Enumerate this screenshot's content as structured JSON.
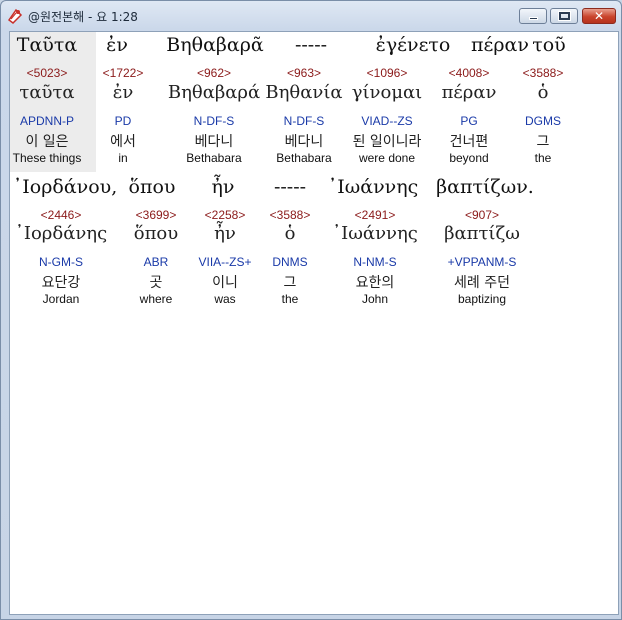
{
  "window": {
    "title": "@원전본해 - 요 1:28",
    "icons": {
      "app": "app-logo-icon",
      "minimize": "minimize-icon",
      "maximize": "maximize-icon",
      "close": "close-icon"
    },
    "close_glyph": "✕"
  },
  "lines": [
    {
      "words": [
        {
          "greek": "Ταῦτα",
          "strong": "<5023>",
          "lemma": "ταῦτα",
          "morph": "APDNN-P",
          "korean": "이 일은",
          "english": "These things"
        },
        {
          "greek": "ἐν",
          "strong": "<1722>",
          "lemma": "ἐν",
          "morph": "PD",
          "korean": "에서",
          "english": "in"
        },
        {
          "greek": "Βηθαβαρᾶ",
          "strong": "<962>",
          "lemma": "Βηθαβαρά",
          "morph": "N-DF-S",
          "korean": "베다니",
          "english": "Bethabara"
        },
        {
          "greek": "-----",
          "strong": "<963>",
          "lemma": "Βηθανία",
          "morph": "N-DF-S",
          "korean": "베다니",
          "english": "Bethabara"
        },
        {
          "greek": "ἐγένετο",
          "strong": "<1096>",
          "lemma": "γίνομαι",
          "morph": "VIAD--ZS",
          "korean": "된 일이니라",
          "english": "were done"
        },
        {
          "greek": "πέραν",
          "strong": "<4008>",
          "lemma": "πέραν",
          "morph": "PG",
          "korean": "건너편",
          "english": "beyond"
        },
        {
          "greek": "τοῦ",
          "strong": "<3588>",
          "lemma": "ὁ",
          "morph": "DGMS",
          "korean": "그",
          "english": "the"
        }
      ]
    },
    {
      "words": [
        {
          "greek": "᾿Ιορδάνου,",
          "strong": "<2446>",
          "lemma": "᾿Ιορδάνης",
          "morph": "N-GM-S",
          "korean": "요단강",
          "english": "Jordan"
        },
        {
          "greek": "ὅπου",
          "strong": "<3699>",
          "lemma": "ὅπου",
          "morph": "ABR",
          "korean": "곳",
          "english": "where"
        },
        {
          "greek": "ἦν",
          "strong": "<2258>",
          "lemma": "ἦν",
          "morph": "VIIA--ZS+",
          "korean": "이니",
          "english": "was"
        },
        {
          "greek": "-----",
          "strong": "<3588>",
          "lemma": "ὁ",
          "morph": "DNMS",
          "korean": "그",
          "english": "the"
        },
        {
          "greek": "᾿Ιωάννης",
          "strong": "<2491>",
          "lemma": "᾿Ιωάννης",
          "morph": "N-NM-S",
          "korean": "요한의",
          "english": "John"
        },
        {
          "greek": "βαπτίζων.",
          "strong": "<907>",
          "lemma": "βαπτίζω",
          "morph": "+VPPANM-S",
          "korean": "세례 주던",
          "english": "baptizing"
        }
      ]
    }
  ]
}
